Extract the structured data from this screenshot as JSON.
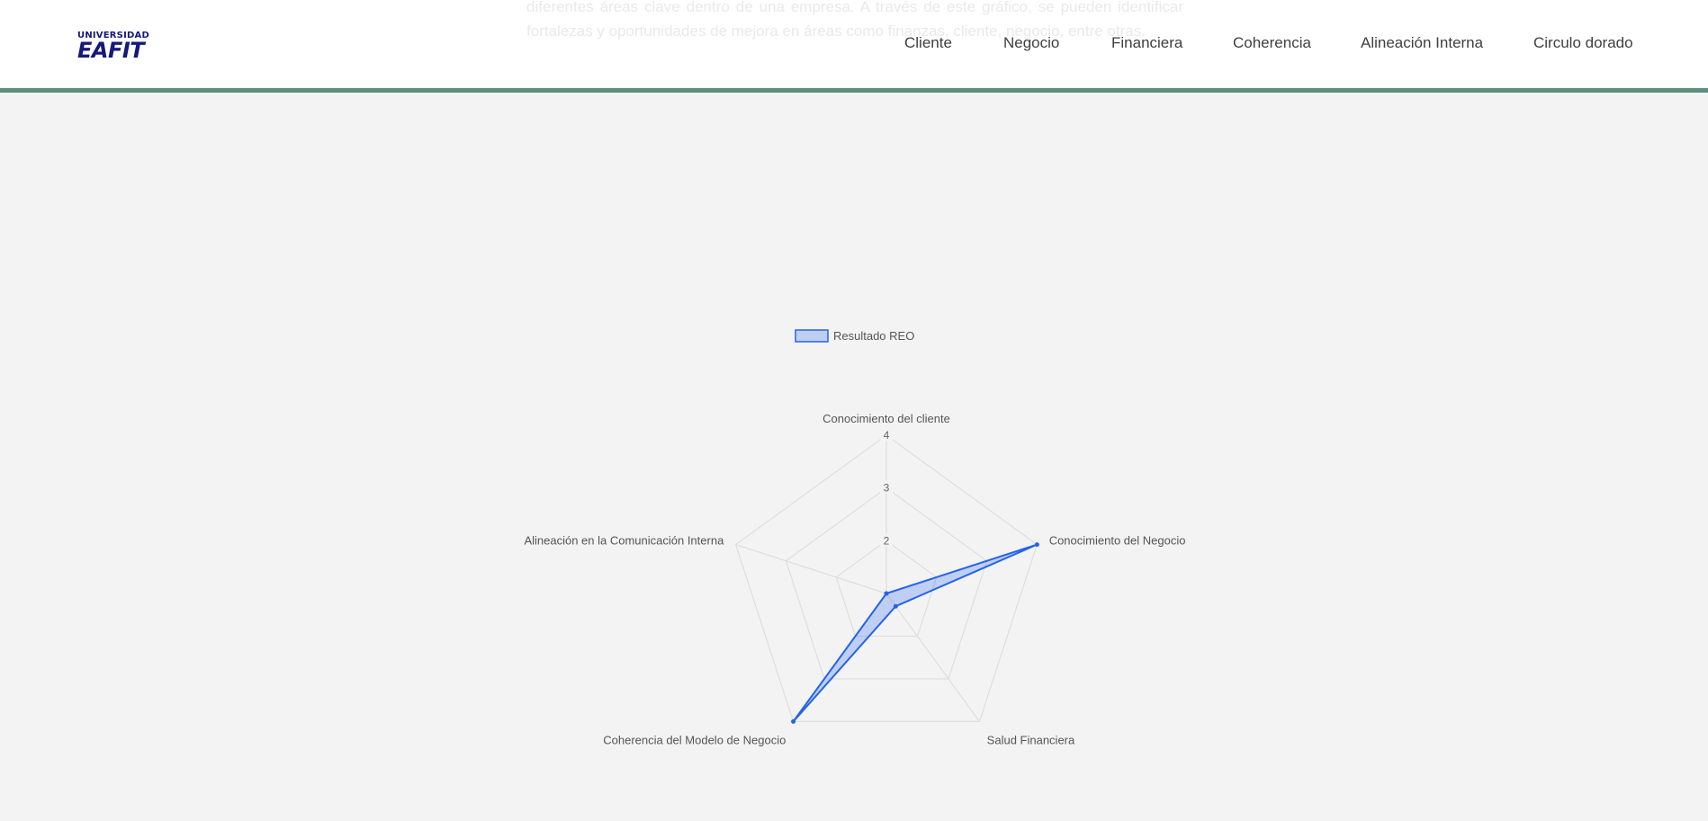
{
  "header": {
    "logo": {
      "top": "UNIVERSIDAD",
      "main": "EAFIT"
    },
    "ghost_text": "diferentes áreas clave dentro de una empresa. A través de este gráfico, se pueden identificar fortalezas y oportunidades de mejora en áreas como finanzas, cliente, negocio, entre otras.",
    "nav": [
      "Cliente",
      "Negocio",
      "Financiera",
      "Coherencia",
      "Alineación Interna",
      "Circulo dorado"
    ]
  },
  "colors": {
    "accent_line": "#5a8f7b",
    "series_stroke": "#2563eb",
    "series_fill": "rgba(37,99,235,0.25)",
    "grid": "#dedede",
    "logo": "#15197a"
  },
  "chart_data": {
    "type": "radar",
    "legend": "Resultado REO",
    "legend_position": "top",
    "axes": [
      "Conocimiento del cliente",
      "Conocimiento del Negocio",
      "Salud Financiera",
      "Coherencia del Modelo de Negocio",
      "Alineación en la Comunicación Interna"
    ],
    "range": [
      1,
      4
    ],
    "ticks": [
      2,
      3,
      4
    ],
    "series": [
      {
        "name": "Resultado REO",
        "values": [
          1,
          4,
          1.3,
          4,
          1
        ]
      }
    ]
  }
}
